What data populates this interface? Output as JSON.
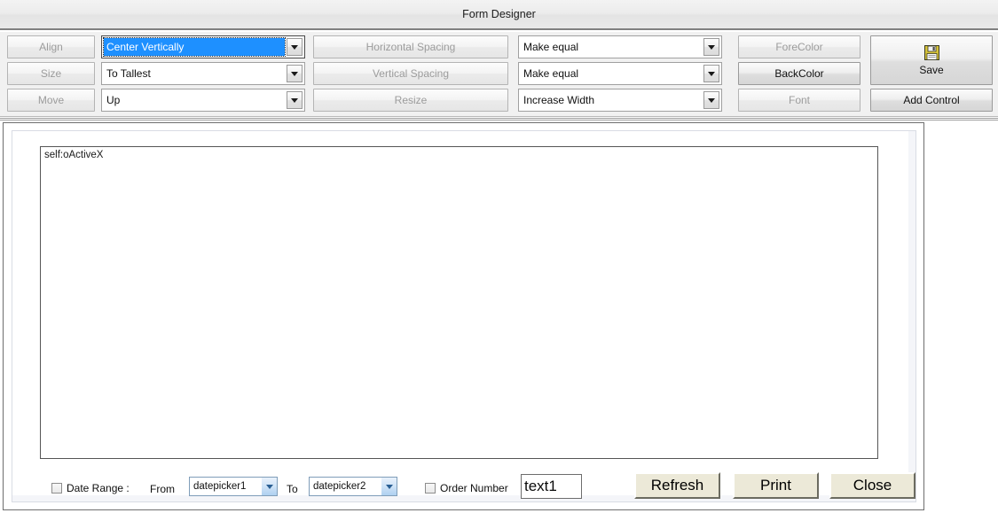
{
  "window": {
    "title": "Form Designer"
  },
  "toolbar": {
    "align_button": "Align",
    "size_button": "Size",
    "move_button": "Move",
    "align_combo": {
      "value": "Center Vertically",
      "focused": true
    },
    "size_combo": {
      "value": "To Tallest",
      "focused": false
    },
    "move_combo": {
      "value": "Up",
      "focused": false
    },
    "horizontal_spacing_button": "Horizontal Spacing",
    "vertical_spacing_button": "Vertical Spacing",
    "resize_button": "Resize",
    "horizontal_spacing_combo": "Make equal",
    "vertical_spacing_combo": "Make equal",
    "resize_combo": "Increase Width",
    "forecolor_button": "ForeColor",
    "backcolor_button": "BackColor",
    "font_button": "Font",
    "save_button": "Save",
    "save_icon": "floppy-disk-save-icon",
    "add_control_button": "Add Control"
  },
  "designer": {
    "activex_label": "self:oActiveX",
    "controls": {
      "date_range_checkbox_label": "Date Range :",
      "from_label": "From",
      "datepicker_from_value": "datepicker1",
      "to_label": "To",
      "datepicker_to_value": "datepicker2",
      "order_number_checkbox_label": "Order Number",
      "order_number_value": "text1",
      "refresh_button": "Refresh",
      "print_button": "Print",
      "close_button": "Close"
    }
  },
  "colors": {
    "selection_blue": "#1e90ff",
    "disabled_text": "#9c9c9c",
    "button_face": "#ece9d8",
    "toolbar_bg": "#f1f1f1"
  }
}
